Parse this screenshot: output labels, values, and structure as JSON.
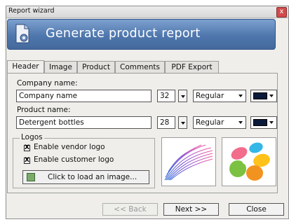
{
  "window": {
    "title": "Report wizard",
    "close_glyph": "x"
  },
  "banner": {
    "heading": "Generate product report",
    "icon": "document-gear-icon"
  },
  "tabs": [
    {
      "label": "Header",
      "active": true
    },
    {
      "label": "Image",
      "active": false
    },
    {
      "label": "Product",
      "active": false
    },
    {
      "label": "Comments",
      "active": false
    },
    {
      "label": "PDF Export",
      "active": false
    }
  ],
  "company": {
    "label": "Company name:",
    "value": "Company name",
    "font_size": "32",
    "style": "Regular",
    "color": "#0b1a3a"
  },
  "product": {
    "label": "Product name:",
    "value": "Detergent bottles",
    "font_size": "28",
    "style": "Regular",
    "color": "#0b1a3a"
  },
  "logos": {
    "title": "Logos",
    "vendor_label": "Enable vendor logo",
    "vendor_checked": true,
    "customer_label": "Enable customer logo",
    "customer_checked": true,
    "load_button": "Click to load an image...",
    "check_mark": "X"
  },
  "buttons": {
    "back": "<< Back",
    "next": "Next >>",
    "close": "Close"
  }
}
